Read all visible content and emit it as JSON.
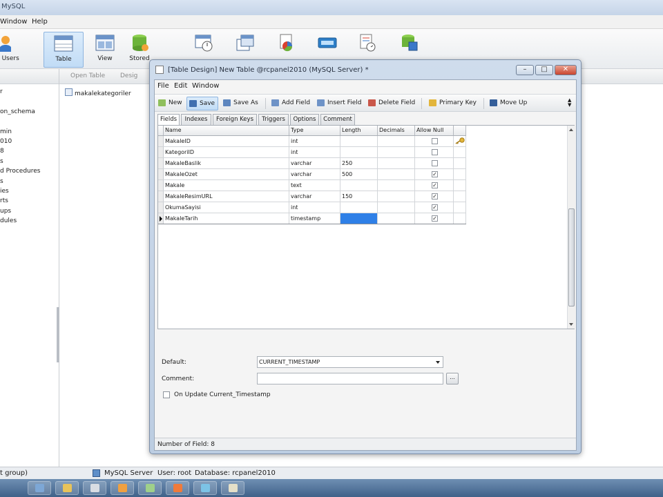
{
  "app": {
    "title": "MySQL",
    "menu": [
      "Window",
      "Help"
    ],
    "toolbar": [
      {
        "label": "e Users",
        "icon": "users-icon"
      },
      {
        "label": "Table",
        "icon": "table-icon",
        "active": true
      },
      {
        "label": "View",
        "icon": "view-icon"
      },
      {
        "label": "Stored",
        "icon": "stored-procedure-icon"
      },
      {
        "label": "",
        "icon": "function-icon"
      },
      {
        "label": "",
        "icon": "trigger-icon"
      },
      {
        "label": "",
        "icon": "report-icon"
      },
      {
        "label": "",
        "icon": "query-icon"
      },
      {
        "label": "",
        "icon": "schedule-icon"
      },
      {
        "label": "",
        "icon": "model-icon"
      }
    ]
  },
  "sidebar": {
    "items": [
      "r",
      "",
      "on_schema",
      "",
      "min",
      "010",
      "8",
      "s",
      "d Procedures",
      "s",
      "ies",
      "rts",
      "ups",
      "dules",
      "",
      "",
      ""
    ]
  },
  "object_panel": {
    "toolbar": {
      "open_table": "Open Table",
      "design": "Desig"
    },
    "items": [
      "makalekategoriler"
    ]
  },
  "dialog": {
    "title": "[Table Design] New Table @rcpanel2010 (MySQL Server) *",
    "menu": {
      "file": "File",
      "edit": "Edit",
      "window": "Window"
    },
    "toolbar": {
      "new": "New",
      "save": "Save",
      "save_as": "Save As",
      "add_field": "Add Field",
      "insert_field": "Insert Field",
      "delete_field": "Delete Field",
      "primary_key": "Primary Key",
      "move_up": "Move Up"
    },
    "tabs": [
      "Fields",
      "Indexes",
      "Foreign Keys",
      "Triggers",
      "Options",
      "Comment"
    ],
    "grid": {
      "headers": [
        "Name",
        "Type",
        "Length",
        "Decimals",
        "Allow Null",
        ""
      ],
      "rows": [
        {
          "name": "MakaleID",
          "type": "int",
          "length": "",
          "decimals": "",
          "allow_null": false,
          "key": true
        },
        {
          "name": "KategoriID",
          "type": "int",
          "length": "",
          "decimals": "",
          "allow_null": false,
          "key": false
        },
        {
          "name": "MakaleBaslik",
          "type": "varchar",
          "length": "250",
          "decimals": "",
          "allow_null": false,
          "key": false
        },
        {
          "name": "MakaleOzet",
          "type": "varchar",
          "length": "500",
          "decimals": "",
          "allow_null": true,
          "key": false
        },
        {
          "name": "Makale",
          "type": "text",
          "length": "",
          "decimals": "",
          "allow_null": true,
          "key": false
        },
        {
          "name": "MakaleResimURL",
          "type": "varchar",
          "length": "150",
          "decimals": "",
          "allow_null": true,
          "key": false
        },
        {
          "name": "OkumaSayisi",
          "type": "int",
          "length": "",
          "decimals": "",
          "allow_null": true,
          "key": false
        },
        {
          "name": "MakaleTarih",
          "type": "timestamp",
          "length": "",
          "decimals": "",
          "allow_null": true,
          "key": false,
          "current": true
        }
      ]
    },
    "props": {
      "default_label": "Default:",
      "default_value": "CURRENT_TIMESTAMP",
      "comment_label": "Comment:",
      "comment_value": "",
      "ellipsis": "...",
      "on_update_label": "On Update Current_Timestamp"
    },
    "status": "Number of Field: 8"
  },
  "status_bar": {
    "group": "t group)",
    "server": "MySQL Server",
    "user": "User: root",
    "database": "Database: rcpanel2010"
  },
  "taskbar_colors": [
    "#7da7d6",
    "#e8c35a",
    "#d9dde3",
    "#f0a040",
    "#9fd08a",
    "#f07a3a",
    "#7cc3e6",
    "#e5e0c8"
  ]
}
